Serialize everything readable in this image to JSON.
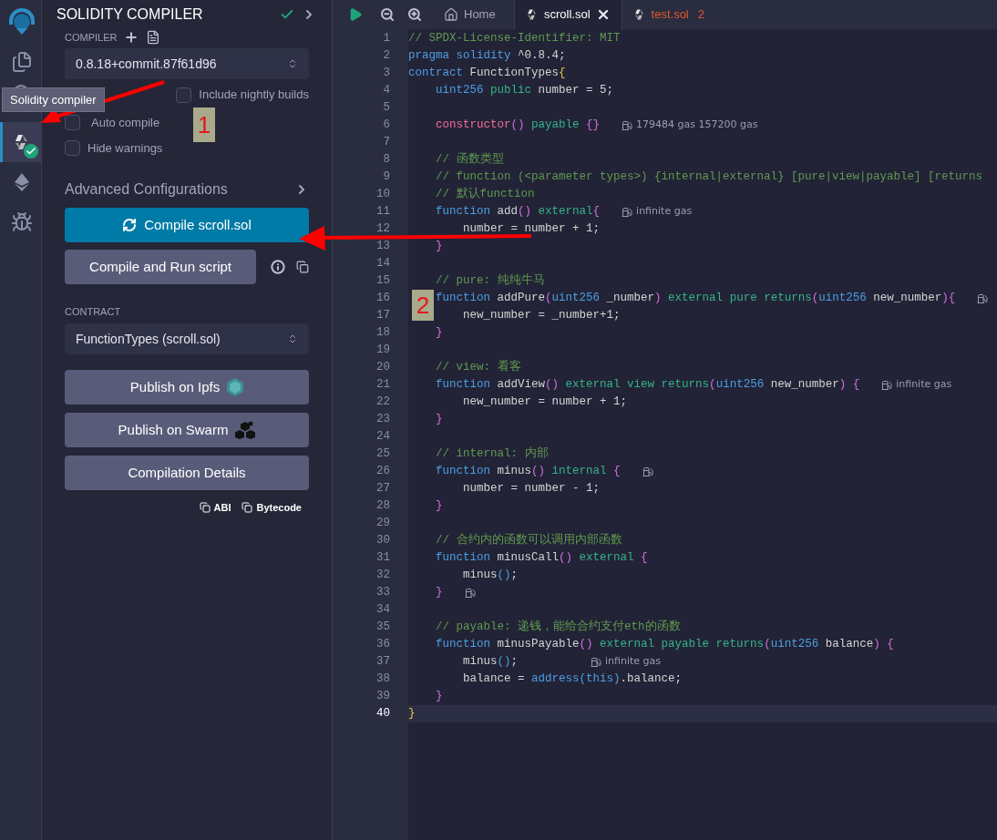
{
  "icon_bar": [
    {
      "kind": "logo",
      "selected": false
    },
    {
      "kind": "files",
      "selected": false
    },
    {
      "kind": "search",
      "selected": false
    },
    {
      "kind": "compiler",
      "selected": true
    },
    {
      "kind": "deploy",
      "selected": false
    },
    {
      "kind": "debugger",
      "selected": false
    }
  ],
  "tooltip": {
    "text": "Solidity compiler"
  },
  "panel": {
    "title": "SOLIDITY COMPILER",
    "compiled": true,
    "compiler_label": "COMPILER",
    "compiler_value": "0.8.18+commit.87f61d96",
    "options": [
      {
        "label": "Include nightly builds",
        "checked": false
      },
      {
        "label": "Auto compile",
        "checked": false
      },
      {
        "label": "Hide warnings",
        "checked": false
      }
    ],
    "advanced": "Advanced Configurations",
    "compile_button": "Compile scroll.sol",
    "run_button": "Compile and Run script",
    "contract_label": "CONTRACT",
    "contract_value": "FunctionTypes (scroll.sol)",
    "actions": [
      {
        "kind": "ipfs",
        "label": "Publish on Ipfs"
      },
      {
        "kind": "swarm",
        "label": "Publish on Swarm"
      },
      {
        "kind": "plain",
        "label": "Compilation Details"
      }
    ],
    "links": [
      "ABI",
      "Bytecode"
    ]
  },
  "tabs": [
    {
      "kind": "home",
      "label": "Home",
      "selected": false,
      "closable": false
    },
    {
      "kind": "file",
      "label": "scroll.sol",
      "selected": true,
      "closable": true
    },
    {
      "kind": "file",
      "label": "test.sol",
      "selected": false,
      "closable": false,
      "errors": "2"
    }
  ],
  "editor": {
    "lines": [
      {
        "n": "1",
        "active": false,
        "tokens": [
          {
            "kind": "com",
            "text": "// SPDX-License-Identifier: MIT"
          }
        ]
      },
      {
        "n": "2",
        "active": false,
        "tokens": [
          {
            "kind": "kw",
            "text": "pragma"
          },
          {
            "kind": "kw",
            "text": " solidity"
          },
          {
            "kind": "txt",
            "text": " ^0.8.4;"
          }
        ]
      },
      {
        "n": "3",
        "active": false,
        "tokens": [
          {
            "kind": "kw",
            "text": "contract"
          },
          {
            "kind": "txt",
            "text": " FunctionTypes"
          },
          {
            "kind": "top",
            "text": "{"
          }
        ]
      },
      {
        "n": "4",
        "active": false,
        "tokens": [
          {
            "kind": "kw",
            "text": "    uint256"
          },
          {
            "kind": "mod",
            "text": " public"
          },
          {
            "kind": "txt",
            "text": " number = 5;"
          }
        ]
      },
      {
        "n": "5",
        "active": false
      },
      {
        "n": "6",
        "active": false,
        "tokens": [
          {
            "kind": "ctor",
            "text": "    constructor"
          },
          {
            "kind": "pun",
            "text": "()"
          },
          {
            "kind": "mod",
            "text": " payable"
          },
          {
            "kind": "pun",
            "text": " {}"
          }
        ],
        "gas": true,
        "gas_text": "179484 gas 157200 gas"
      },
      {
        "n": "7",
        "active": false
      },
      {
        "n": "8",
        "active": false,
        "tokens": [
          {
            "kind": "com",
            "text": "    // 函数类型"
          }
        ]
      },
      {
        "n": "9",
        "active": false,
        "tokens": [
          {
            "kind": "com",
            "text": "    // function (<parameter types>) {internal|external} [pure|view|payable] [returns"
          }
        ]
      },
      {
        "n": "10",
        "active": false,
        "tokens": [
          {
            "kind": "com",
            "text": "    // 默认function"
          }
        ]
      },
      {
        "n": "11",
        "active": false,
        "tokens": [
          {
            "kind": "kw",
            "text": "    function"
          },
          {
            "kind": "txt",
            "text": " add"
          },
          {
            "kind": "pun",
            "text": "()"
          },
          {
            "kind": "mod",
            "text": " external"
          },
          {
            "kind": "pun",
            "text": "{"
          }
        ],
        "gas": true,
        "gas_text": "infinite gas"
      },
      {
        "n": "12",
        "active": false,
        "tokens": [
          {
            "kind": "txt",
            "text": "        number = number + 1;"
          }
        ]
      },
      {
        "n": "13",
        "active": false,
        "tokens": [
          {
            "kind": "pun",
            "text": "    }"
          }
        ]
      },
      {
        "n": "14",
        "active": false
      },
      {
        "n": "15",
        "active": false,
        "tokens": [
          {
            "kind": "com",
            "text": "    // pure: 纯纯牛马"
          }
        ]
      },
      {
        "n": "16",
        "active": false,
        "tokens": [
          {
            "kind": "kw",
            "text": "    function"
          },
          {
            "kind": "txt",
            "text": " addPure"
          },
          {
            "kind": "pun",
            "text": "("
          },
          {
            "kind": "kw",
            "text": "uint256"
          },
          {
            "kind": "txt",
            "text": " _number"
          },
          {
            "kind": "pun",
            "text": ")"
          },
          {
            "kind": "mod",
            "text": " external"
          },
          {
            "kind": "mod",
            "text": " pure"
          },
          {
            "kind": "mod",
            "text": " returns"
          },
          {
            "kind": "pun",
            "text": "("
          },
          {
            "kind": "kw",
            "text": "uint256"
          },
          {
            "kind": "txt",
            "text": " new_number"
          },
          {
            "kind": "pun",
            "text": "){"
          }
        ],
        "gas": true
      },
      {
        "n": "17",
        "active": false,
        "tokens": [
          {
            "kind": "txt",
            "text": "        new_number = _number+1;"
          }
        ]
      },
      {
        "n": "18",
        "active": false,
        "tokens": [
          {
            "kind": "pun",
            "text": "    }"
          }
        ]
      },
      {
        "n": "19",
        "active": false
      },
      {
        "n": "20",
        "active": false,
        "tokens": [
          {
            "kind": "com",
            "text": "    // view: 看客"
          }
        ]
      },
      {
        "n": "21",
        "active": false,
        "tokens": [
          {
            "kind": "kw",
            "text": "    function"
          },
          {
            "kind": "txt",
            "text": " addView"
          },
          {
            "kind": "pun",
            "text": "()"
          },
          {
            "kind": "mod",
            "text": " external"
          },
          {
            "kind": "mod",
            "text": " view"
          },
          {
            "kind": "mod",
            "text": " returns"
          },
          {
            "kind": "pun",
            "text": "("
          },
          {
            "kind": "kw",
            "text": "uint256"
          },
          {
            "kind": "txt",
            "text": " new_number"
          },
          {
            "kind": "pun",
            "text": ") {"
          }
        ],
        "gas": true,
        "gas_text": "infinite gas"
      },
      {
        "n": "22",
        "active": false,
        "tokens": [
          {
            "kind": "txt",
            "text": "        new_number = number + 1;"
          }
        ]
      },
      {
        "n": "23",
        "active": false,
        "tokens": [
          {
            "kind": "pun",
            "text": "    }"
          }
        ]
      },
      {
        "n": "24",
        "active": false
      },
      {
        "n": "25",
        "active": false,
        "tokens": [
          {
            "kind": "com",
            "text": "    // internal: 内部"
          }
        ]
      },
      {
        "n": "26",
        "active": false,
        "tokens": [
          {
            "kind": "kw",
            "text": "    function"
          },
          {
            "kind": "txt",
            "text": " minus"
          },
          {
            "kind": "pun",
            "text": "()"
          },
          {
            "kind": "mod",
            "text": " internal"
          },
          {
            "kind": "pun",
            "text": " {"
          }
        ],
        "gas": true
      },
      {
        "n": "27",
        "active": false,
        "tokens": [
          {
            "kind": "txt",
            "text": "        number = number - 1;"
          }
        ]
      },
      {
        "n": "28",
        "active": false,
        "tokens": [
          {
            "kind": "pun",
            "text": "    }"
          }
        ]
      },
      {
        "n": "29",
        "active": false
      },
      {
        "n": "30",
        "active": false,
        "tokens": [
          {
            "kind": "com",
            "text": "    // 合约内的函数可以调用内部函数"
          }
        ]
      },
      {
        "n": "31",
        "active": false,
        "tokens": [
          {
            "kind": "kw",
            "text": "    function"
          },
          {
            "kind": "txt",
            "text": " minusCall"
          },
          {
            "kind": "pun",
            "text": "()"
          },
          {
            "kind": "mod",
            "text": " external"
          },
          {
            "kind": "pun",
            "text": " {"
          }
        ]
      },
      {
        "n": "32",
        "active": false,
        "tokens": [
          {
            "kind": "txt",
            "text": "        minus"
          },
          {
            "kind": "call",
            "text": "()"
          },
          {
            "kind": "txt",
            "text": ";"
          }
        ]
      },
      {
        "n": "33",
        "active": false,
        "tokens": [
          {
            "kind": "pun",
            "text": "    }"
          }
        ],
        "gas": true
      },
      {
        "n": "34",
        "active": false
      },
      {
        "n": "35",
        "active": false,
        "tokens": [
          {
            "kind": "com",
            "text": "    // payable: 递钱，能给合约支付eth的函数"
          }
        ]
      },
      {
        "n": "36",
        "active": false,
        "tokens": [
          {
            "kind": "kw",
            "text": "    function"
          },
          {
            "kind": "txt",
            "text": " minusPayable"
          },
          {
            "kind": "pun",
            "text": "()"
          },
          {
            "kind": "mod",
            "text": " external"
          },
          {
            "kind": "mod",
            "text": " payable"
          },
          {
            "kind": "mod",
            "text": " returns"
          },
          {
            "kind": "pun",
            "text": "("
          },
          {
            "kind": "kw",
            "text": "uint256"
          },
          {
            "kind": "txt",
            "text": " balance"
          },
          {
            "kind": "pun",
            "text": ") {"
          }
        ]
      },
      {
        "n": "37",
        "active": false,
        "tokens": [
          {
            "kind": "txt",
            "text": "        minus"
          },
          {
            "kind": "call",
            "text": "()"
          },
          {
            "kind": "txt",
            "text": ";"
          }
        ],
        "gas": true,
        "gas_text": "infinite gas"
      },
      {
        "n": "38",
        "active": false,
        "tokens": [
          {
            "kind": "txt",
            "text": "        balance = "
          },
          {
            "kind": "kw",
            "text": "address"
          },
          {
            "kind": "call",
            "text": "("
          },
          {
            "kind": "kw",
            "text": "this"
          },
          {
            "kind": "call",
            "text": ")"
          },
          {
            "kind": "txt",
            "text": ".balance;"
          }
        ]
      },
      {
        "n": "39",
        "active": false,
        "tokens": [
          {
            "kind": "pun",
            "text": "    }"
          }
        ]
      },
      {
        "n": "40",
        "active": true,
        "tokens": [
          {
            "kind": "top",
            "text": "}"
          }
        ]
      }
    ]
  },
  "annotations": [
    {
      "label": "1"
    },
    {
      "label": "2"
    }
  ]
}
